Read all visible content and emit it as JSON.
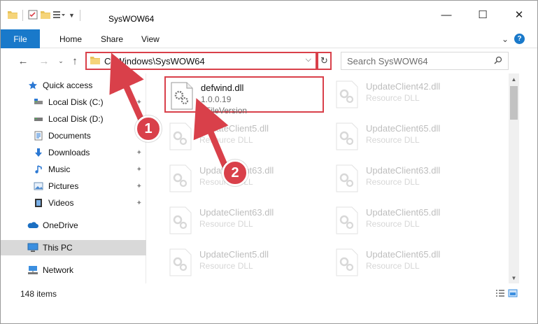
{
  "window": {
    "title": "SysWOW64",
    "controls": {
      "minimize": "—",
      "maximize": "☐",
      "close": "✕"
    }
  },
  "ribbon": {
    "tabs": [
      "File",
      "Home",
      "Share",
      "View"
    ],
    "expand_glyph": "⌄",
    "help_glyph": "?"
  },
  "address_bar": {
    "path": "C:\\Windows\\SysWOW64",
    "dropdown_glyph": "⌵",
    "refresh_glyph": "↻"
  },
  "search": {
    "placeholder": "Search SysWOW64"
  },
  "sidebar": {
    "items": [
      {
        "label": "Quick access",
        "icon": "star-icon",
        "pinned": false
      },
      {
        "label": "Local Disk (C:)",
        "icon": "drive-icon",
        "pinned": true
      },
      {
        "label": "Local Disk (D:)",
        "icon": "drive-icon",
        "pinned": true
      },
      {
        "label": "Documents",
        "icon": "documents-icon",
        "pinned": true
      },
      {
        "label": "Downloads",
        "icon": "downloads-icon",
        "pinned": true
      },
      {
        "label": "Music",
        "icon": "music-icon",
        "pinned": true
      },
      {
        "label": "Pictures",
        "icon": "pictures-icon",
        "pinned": true
      },
      {
        "label": "Videos",
        "icon": "videos-icon",
        "pinned": true
      },
      {
        "label": "OneDrive",
        "icon": "onedrive-icon",
        "pinned": false
      },
      {
        "label": "This PC",
        "icon": "pc-icon",
        "pinned": false,
        "selected": true
      },
      {
        "label": "Network",
        "icon": "network-icon",
        "pinned": false
      }
    ],
    "pin_glyph": "📌"
  },
  "files": [
    {
      "name": "defwind.dll",
      "line1": "1.0.0.19",
      "line2": "8FileVersion",
      "highlighted": true
    },
    {
      "name": "UpdateClient42.dll",
      "line1": "Resource DLL",
      "line2": ""
    },
    {
      "name": "UpdateClient5.dll",
      "line1": "Resource DLL",
      "line2": ""
    },
    {
      "name": "UpdateClient65.dll",
      "line1": "Resource DLL",
      "line2": ""
    },
    {
      "name": "UpdateClient63.dll",
      "line1": "Resource DLL",
      "line2": ""
    },
    {
      "name": "UpdateClient63.dll",
      "line1": "Resource DLL",
      "line2": ""
    },
    {
      "name": "UpdateClient63.dll",
      "line1": "Resource DLL",
      "line2": ""
    },
    {
      "name": "UpdateClient65.dll",
      "line1": "Resource DLL",
      "line2": ""
    },
    {
      "name": "UpdateClient5.dll",
      "line1": "Resource DLL",
      "line2": ""
    },
    {
      "name": "UpdateClient65.dll",
      "line1": "Resource DLL",
      "line2": ""
    }
  ],
  "status": {
    "count": "148 items"
  },
  "callouts": [
    {
      "label": "1"
    },
    {
      "label": "2"
    }
  ],
  "colors": {
    "accent": "#1979ca",
    "highlight": "#d9404a",
    "selected_bg": "#d9d9d9"
  }
}
